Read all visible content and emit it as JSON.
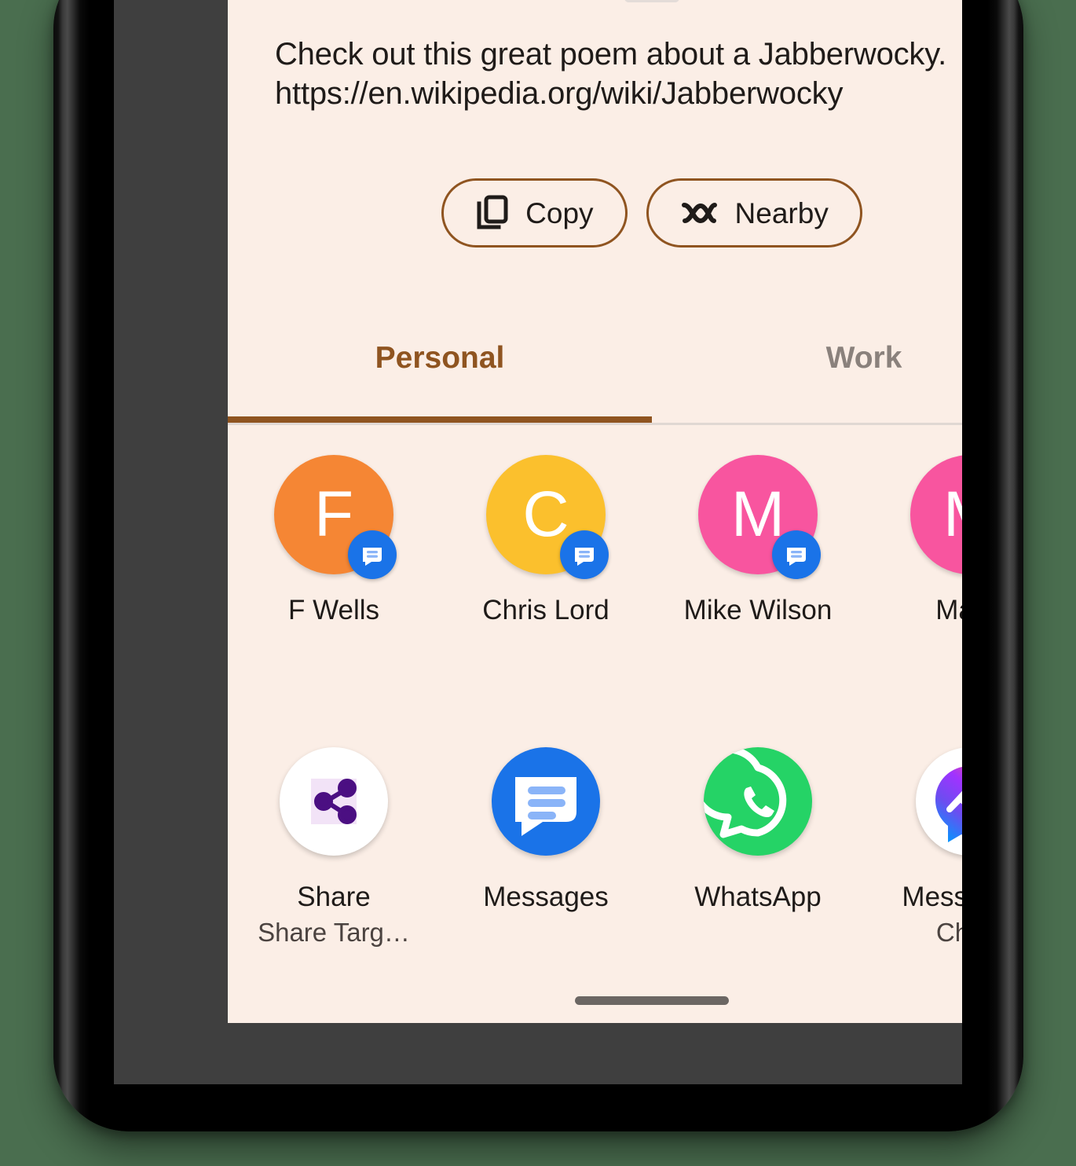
{
  "sheet": {
    "drag_handle": "drag-handle",
    "preview": {
      "line1": "Check out this great poem about a Jabberwocky.",
      "line2": "https://en.wikipedia.org/wiki/Jabberwocky"
    },
    "actions": [
      {
        "label": "Copy",
        "icon": "copy-icon"
      },
      {
        "label": "Nearby",
        "icon": "nearby-share-icon"
      }
    ],
    "tabs": [
      {
        "label": "Personal",
        "active": true
      },
      {
        "label": "Work",
        "active": false
      }
    ],
    "contacts": [
      {
        "label": "F Wells",
        "initial": "F",
        "color": "#f58634",
        "badge": "messages-icon"
      },
      {
        "label": "Chris Lord",
        "initial": "C",
        "color": "#fbc02d",
        "badge": "messages-icon"
      },
      {
        "label": "Mike Wilson",
        "initial": "M",
        "color": "#f8559f",
        "badge": "messages-icon"
      },
      {
        "label": "Marty",
        "initial": "M",
        "color": "#f8559f",
        "badge": "messages-icon"
      }
    ],
    "apps": [
      {
        "label": "Share",
        "sublabel": "Share Targ…",
        "icon": "share-target-icon"
      },
      {
        "label": "Messages",
        "sublabel": "",
        "icon": "messages-app-icon"
      },
      {
        "label": "WhatsApp",
        "sublabel": "",
        "icon": "whatsapp-icon"
      },
      {
        "label": "Messenger",
        "sublabel": "Chats",
        "icon": "messenger-icon"
      }
    ]
  },
  "colors": {
    "sheet_background": "#fbeee6",
    "accent": "#8f5420",
    "inactive_tab": "#8a817c",
    "badge_blue": "#1a73e8",
    "wallpaper": "#4a6e4f"
  }
}
